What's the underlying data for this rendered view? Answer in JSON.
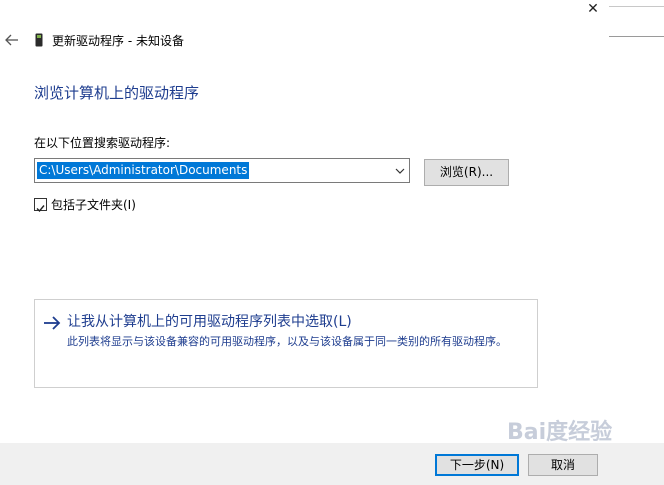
{
  "window": {
    "title": "更新驱动程序 - 未知设备",
    "close_symbol": "✕"
  },
  "page": {
    "heading": "浏览计算机上的驱动程序",
    "search_label": "在以下位置搜索驱动程序:",
    "path_value": "C:\\Users\\Administrator\\Documents",
    "browse_label": "浏览(R)...",
    "include_subfolders_label": "包括子文件夹(I)",
    "include_subfolders_checked": true
  },
  "pick_option": {
    "title": "让我从计算机上的可用驱动程序列表中选取(L)",
    "description": "此列表将显示与该设备兼容的可用驱动程序，以及与该设备属于同一类别的所有驱动程序。"
  },
  "footer": {
    "next_label": "下一步(N)",
    "cancel_label": "取消"
  },
  "watermark": {
    "text": "Bai度经验"
  },
  "icons": {
    "back": "back-arrow-icon",
    "device": "device-icon",
    "dropdown": "chevron-down-icon",
    "pick_arrow": "right-arrow-icon"
  },
  "colors": {
    "link_blue": "#1e3d8f",
    "selection_blue": "#0078d7",
    "footer_bg": "#f0f0f0",
    "button_bg": "#e1e1e1"
  }
}
